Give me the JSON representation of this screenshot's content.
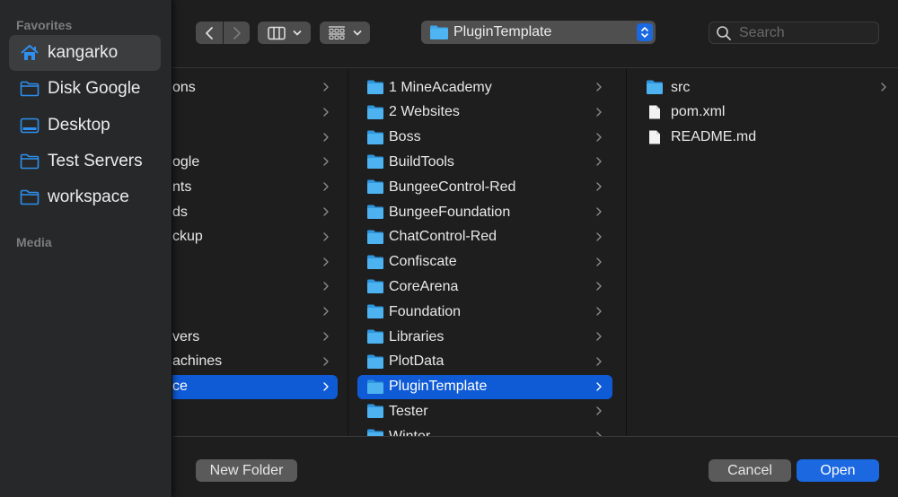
{
  "sidebar": {
    "favorites_heading": "Favorites",
    "media_heading": "Media",
    "items": [
      {
        "label": "kangarko",
        "icon": "home-icon",
        "active": true
      },
      {
        "label": "Disk Google",
        "icon": "folder-icon",
        "active": false
      },
      {
        "label": "Desktop",
        "icon": "desktop-icon",
        "active": false
      },
      {
        "label": "Test Servers",
        "icon": "folder-icon",
        "active": false
      },
      {
        "label": "workspace",
        "icon": "folder-icon",
        "active": false
      }
    ]
  },
  "toolbar": {
    "back_icon": "chevron-left-icon",
    "forward_icon": "chevron-right-icon",
    "view_mode_icon": "column-view-icon",
    "group_icon": "grid-group-icon",
    "path_popup": {
      "label": "PluginTemplate",
      "icon": "folder-icon"
    },
    "search": {
      "placeholder": "Search",
      "value": ""
    }
  },
  "columns": {
    "col1": [
      {
        "label": "ons",
        "has_children": true
      },
      {
        "label": "",
        "has_children": true
      },
      {
        "label": "",
        "has_children": true
      },
      {
        "label": "ogle",
        "has_children": true
      },
      {
        "label": "nts",
        "has_children": true
      },
      {
        "label": "ds",
        "has_children": true
      },
      {
        "label": "ckup",
        "has_children": true
      },
      {
        "label": "",
        "has_children": true
      },
      {
        "label": "",
        "has_children": true
      },
      {
        "label": "",
        "has_children": true
      },
      {
        "label": "vers",
        "has_children": true
      },
      {
        "label": "achines",
        "has_children": true
      },
      {
        "label": "ce",
        "has_children": true,
        "selected": true
      }
    ],
    "col2": [
      {
        "label": "1 MineAcademy",
        "type": "folder"
      },
      {
        "label": "2 Websites",
        "type": "folder"
      },
      {
        "label": "Boss",
        "type": "folder"
      },
      {
        "label": "BuildTools",
        "type": "folder"
      },
      {
        "label": "BungeeControl-Red",
        "type": "folder"
      },
      {
        "label": "BungeeFoundation",
        "type": "folder"
      },
      {
        "label": "ChatControl-Red",
        "type": "folder"
      },
      {
        "label": "Confiscate",
        "type": "folder"
      },
      {
        "label": "CoreArena",
        "type": "folder"
      },
      {
        "label": "Foundation",
        "type": "folder"
      },
      {
        "label": "Libraries",
        "type": "folder"
      },
      {
        "label": "PlotData",
        "type": "folder"
      },
      {
        "label": "PluginTemplate",
        "type": "folder",
        "selected": true
      },
      {
        "label": "Tester",
        "type": "folder"
      },
      {
        "label": "Winter",
        "type": "folder"
      }
    ],
    "col3": [
      {
        "label": "src",
        "type": "folder"
      },
      {
        "label": "pom.xml",
        "type": "file"
      },
      {
        "label": "README.md",
        "type": "file"
      }
    ]
  },
  "footer": {
    "new_folder_label": "New Folder",
    "cancel_label": "Cancel",
    "open_label": "Open"
  },
  "colors": {
    "accent": "#1b68e0",
    "selection": "#0f5bd6",
    "folder_blue": "#3ea6ea",
    "background": "#1e1e1e",
    "sidebar": "#262829"
  }
}
